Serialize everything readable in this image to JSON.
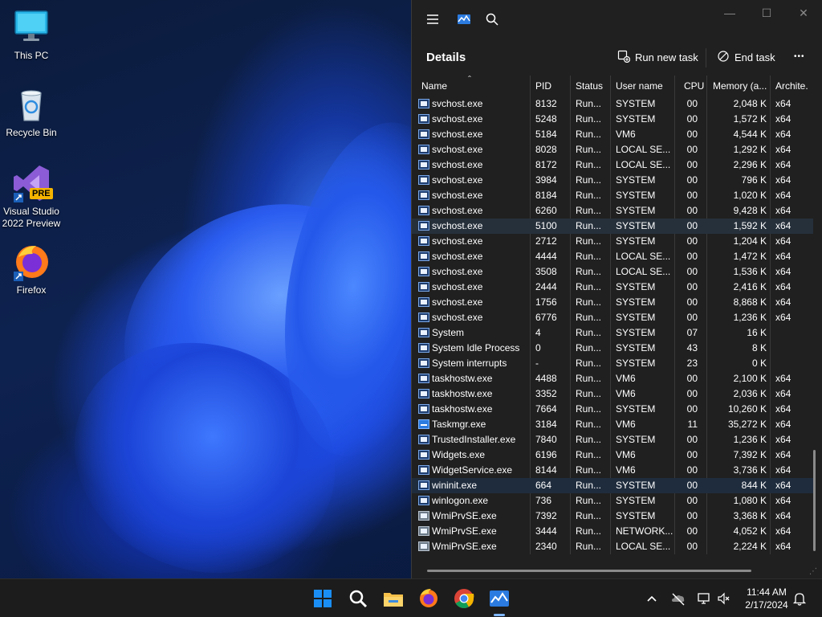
{
  "desktop": {
    "icons": [
      {
        "label": "This PC"
      },
      {
        "label": "Recycle Bin"
      },
      {
        "label": "Visual Studio 2022 Preview",
        "badge": "PRE"
      },
      {
        "label": "Firefox"
      }
    ]
  },
  "window": {
    "page_title": "Details",
    "run_new_task": "Run new task",
    "end_task": "End task",
    "more": "•••",
    "controls": {
      "minimize": "—",
      "maximize": "☐",
      "close": "✕"
    },
    "sort_indicator": "ˆ",
    "columns": [
      "Name",
      "PID",
      "Status",
      "User name",
      "CPU",
      "Memory (a...",
      "Archite."
    ],
    "rows": [
      {
        "name": "svchost.exe",
        "pid": "8132",
        "status": "Run...",
        "user": "SYSTEM",
        "cpu": "00",
        "mem": "2,048 K",
        "arch": "x64",
        "icon": "app"
      },
      {
        "name": "svchost.exe",
        "pid": "5248",
        "status": "Run...",
        "user": "SYSTEM",
        "cpu": "00",
        "mem": "1,572 K",
        "arch": "x64",
        "icon": "app"
      },
      {
        "name": "svchost.exe",
        "pid": "5184",
        "status": "Run...",
        "user": "VM6",
        "cpu": "00",
        "mem": "4,544 K",
        "arch": "x64",
        "icon": "app"
      },
      {
        "name": "svchost.exe",
        "pid": "8028",
        "status": "Run...",
        "user": "LOCAL SE...",
        "cpu": "00",
        "mem": "1,292 K",
        "arch": "x64",
        "icon": "app"
      },
      {
        "name": "svchost.exe",
        "pid": "8172",
        "status": "Run...",
        "user": "LOCAL SE...",
        "cpu": "00",
        "mem": "2,296 K",
        "arch": "x64",
        "icon": "app"
      },
      {
        "name": "svchost.exe",
        "pid": "3984",
        "status": "Run...",
        "user": "SYSTEM",
        "cpu": "00",
        "mem": "796 K",
        "arch": "x64",
        "icon": "app"
      },
      {
        "name": "svchost.exe",
        "pid": "8184",
        "status": "Run...",
        "user": "SYSTEM",
        "cpu": "00",
        "mem": "1,020 K",
        "arch": "x64",
        "icon": "app"
      },
      {
        "name": "svchost.exe",
        "pid": "6260",
        "status": "Run...",
        "user": "SYSTEM",
        "cpu": "00",
        "mem": "9,428 K",
        "arch": "x64",
        "icon": "app"
      },
      {
        "name": "svchost.exe",
        "pid": "5100",
        "status": "Run...",
        "user": "SYSTEM",
        "cpu": "00",
        "mem": "1,592 K",
        "arch": "x64",
        "icon": "app",
        "hover": true
      },
      {
        "name": "svchost.exe",
        "pid": "2712",
        "status": "Run...",
        "user": "SYSTEM",
        "cpu": "00",
        "mem": "1,204 K",
        "arch": "x64",
        "icon": "app"
      },
      {
        "name": "svchost.exe",
        "pid": "4444",
        "status": "Run...",
        "user": "LOCAL SE...",
        "cpu": "00",
        "mem": "1,472 K",
        "arch": "x64",
        "icon": "app"
      },
      {
        "name": "svchost.exe",
        "pid": "3508",
        "status": "Run...",
        "user": "LOCAL SE...",
        "cpu": "00",
        "mem": "1,536 K",
        "arch": "x64",
        "icon": "app"
      },
      {
        "name": "svchost.exe",
        "pid": "2444",
        "status": "Run...",
        "user": "SYSTEM",
        "cpu": "00",
        "mem": "2,416 K",
        "arch": "x64",
        "icon": "app"
      },
      {
        "name": "svchost.exe",
        "pid": "1756",
        "status": "Run...",
        "user": "SYSTEM",
        "cpu": "00",
        "mem": "8,868 K",
        "arch": "x64",
        "icon": "app"
      },
      {
        "name": "svchost.exe",
        "pid": "6776",
        "status": "Run...",
        "user": "SYSTEM",
        "cpu": "00",
        "mem": "1,236 K",
        "arch": "x64",
        "icon": "app"
      },
      {
        "name": "System",
        "pid": "4",
        "status": "Run...",
        "user": "SYSTEM",
        "cpu": "07",
        "mem": "16 K",
        "arch": "",
        "icon": "app"
      },
      {
        "name": "System Idle Process",
        "pid": "0",
        "status": "Run...",
        "user": "SYSTEM",
        "cpu": "43",
        "mem": "8 K",
        "arch": "",
        "icon": "app"
      },
      {
        "name": "System interrupts",
        "pid": "-",
        "status": "Run...",
        "user": "SYSTEM",
        "cpu": "23",
        "mem": "0 K",
        "arch": "",
        "icon": "app"
      },
      {
        "name": "taskhostw.exe",
        "pid": "4488",
        "status": "Run...",
        "user": "VM6",
        "cpu": "00",
        "mem": "2,100 K",
        "arch": "x64",
        "icon": "app"
      },
      {
        "name": "taskhostw.exe",
        "pid": "3352",
        "status": "Run...",
        "user": "VM6",
        "cpu": "00",
        "mem": "2,036 K",
        "arch": "x64",
        "icon": "app"
      },
      {
        "name": "taskhostw.exe",
        "pid": "7664",
        "status": "Run...",
        "user": "SYSTEM",
        "cpu": "00",
        "mem": "10,260 K",
        "arch": "x64",
        "icon": "app"
      },
      {
        "name": "Taskmgr.exe",
        "pid": "3184",
        "status": "Run...",
        "user": "VM6",
        "cpu": "11",
        "mem": "35,272 K",
        "arch": "x64",
        "icon": "tm"
      },
      {
        "name": "TrustedInstaller.exe",
        "pid": "7840",
        "status": "Run...",
        "user": "SYSTEM",
        "cpu": "00",
        "mem": "1,236 K",
        "arch": "x64",
        "icon": "app"
      },
      {
        "name": "Widgets.exe",
        "pid": "6196",
        "status": "Run...",
        "user": "VM6",
        "cpu": "00",
        "mem": "7,392 K",
        "arch": "x64",
        "icon": "app"
      },
      {
        "name": "WidgetService.exe",
        "pid": "8144",
        "status": "Run...",
        "user": "VM6",
        "cpu": "00",
        "mem": "3,736 K",
        "arch": "x64",
        "icon": "app"
      },
      {
        "name": "wininit.exe",
        "pid": "664",
        "status": "Run...",
        "user": "SYSTEM",
        "cpu": "00",
        "mem": "844 K",
        "arch": "x64",
        "icon": "app",
        "selected": true
      },
      {
        "name": "winlogon.exe",
        "pid": "736",
        "status": "Run...",
        "user": "SYSTEM",
        "cpu": "00",
        "mem": "1,080 K",
        "arch": "x64",
        "icon": "app"
      },
      {
        "name": "WmiPrvSE.exe",
        "pid": "7392",
        "status": "Run...",
        "user": "SYSTEM",
        "cpu": "00",
        "mem": "3,368 K",
        "arch": "x64",
        "icon": "wmi"
      },
      {
        "name": "WmiPrvSE.exe",
        "pid": "3444",
        "status": "Run...",
        "user": "NETWORK...",
        "cpu": "00",
        "mem": "4,052 K",
        "arch": "x64",
        "icon": "wmi"
      },
      {
        "name": "WmiPrvSE.exe",
        "pid": "2340",
        "status": "Run...",
        "user": "LOCAL SE...",
        "cpu": "00",
        "mem": "2,224 K",
        "arch": "x64",
        "icon": "wmi"
      }
    ]
  },
  "taskbar": {
    "clock_time": "11:44 AM",
    "clock_date": "2/17/2024"
  },
  "colors": {
    "window_bg": "#202020",
    "accent": "#7fb6ff",
    "selected_row": "#1f2c3d"
  }
}
